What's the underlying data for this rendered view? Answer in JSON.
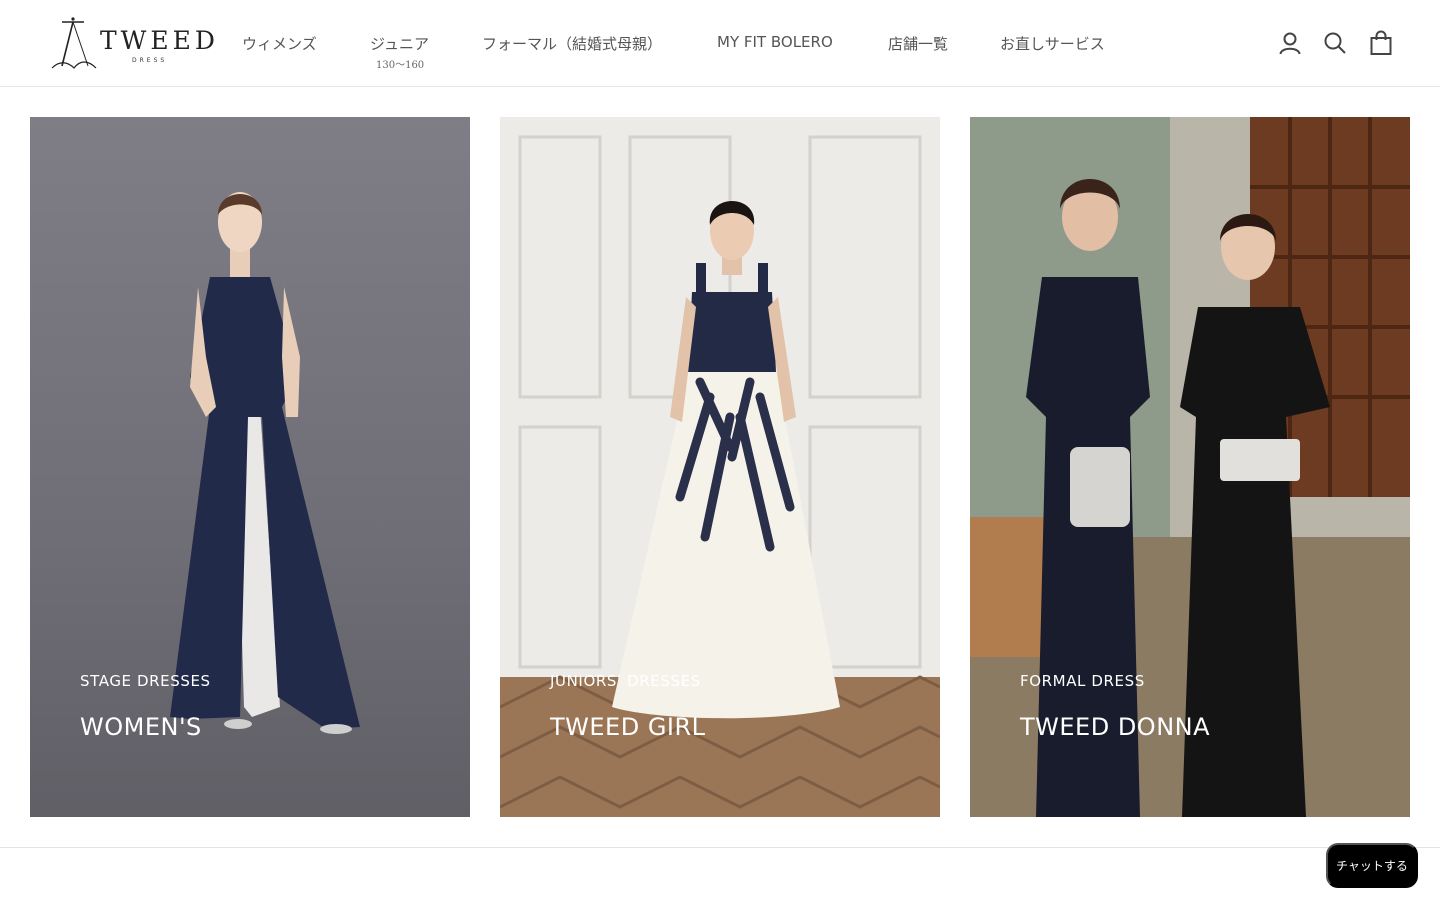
{
  "header": {
    "logo": {
      "name": "TWEED",
      "tagline": "DRESS"
    },
    "nav": [
      {
        "label": "ウィメンズ"
      },
      {
        "label": "ジュニア",
        "sub": "130～160"
      },
      {
        "label": "フォーマル（結婚式母親）"
      },
      {
        "label": "MY FIT BOLERO"
      },
      {
        "label": "店舗一覧"
      },
      {
        "label": "お直しサービス"
      }
    ],
    "icons": [
      "account-icon",
      "search-icon",
      "cart-icon"
    ]
  },
  "collections": [
    {
      "kicker": "STAGE DRESSES",
      "title": "WOMEN'S"
    },
    {
      "kicker": "JUNIORS' DRESSES",
      "title": "TWEED GIRL"
    },
    {
      "kicker": "FORMAL DRESS",
      "title": "TWEED DONNA"
    }
  ],
  "chat": {
    "label": "チャットする"
  },
  "colors": {
    "text": "#555555",
    "chat_bg": "#000000",
    "divider": "#e6e6e6"
  }
}
